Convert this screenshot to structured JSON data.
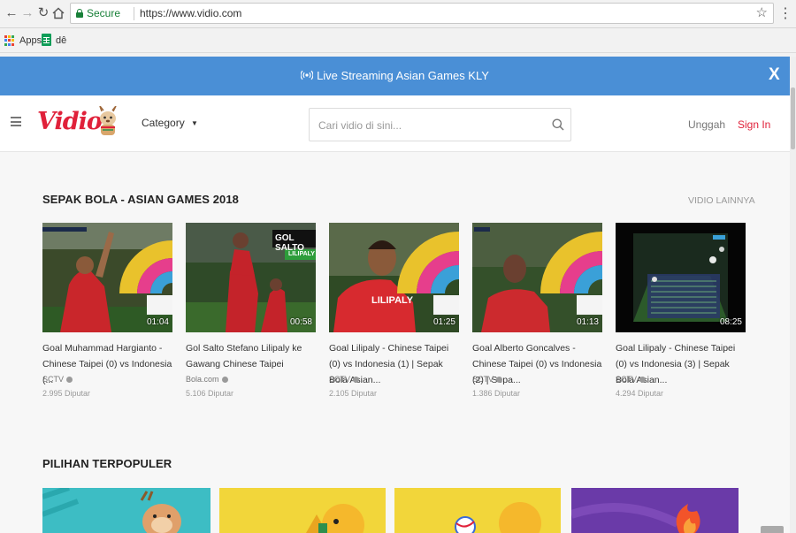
{
  "browser": {
    "secure_label": "Secure",
    "url": "https://www.vidio.com",
    "bookmarks": [
      {
        "label": "Apps",
        "icon": "apps-grid-icon"
      },
      {
        "label": "dê",
        "icon": "sheets-icon"
      }
    ]
  },
  "banner": {
    "text": "Live Streaming Asian Games KLY",
    "close_label": "X",
    "color": "#4a8fd6"
  },
  "header": {
    "logo": "Vidio",
    "category_label": "Category",
    "search_placeholder": "Cari vidio di sini...",
    "upload_label": "Unggah",
    "signin_label": "Sign In",
    "brand_color": "#e0213a"
  },
  "section_football": {
    "title": "SEPAK BOLA - ASIAN GAMES 2018",
    "more_label": "VIDIO LAINNYA",
    "videos": [
      {
        "title": "Goal Muhammad Hargianto - Chinese Taipei (0) vs Indonesia (...",
        "channel": "SCTV",
        "views": "2.995 Diputar",
        "duration": "01:04"
      },
      {
        "title": "Gol Salto Stefano Lilipaly ke Gawang Chinese Taipei",
        "channel": "Bola.com",
        "views": "5.106 Diputar",
        "duration": "00:58",
        "overlay_top": "GOL SALTO",
        "overlay_bottom": "LILIPALY"
      },
      {
        "title": "Goal Lilipaly - Chinese Taipei (0) vs Indonesia (1) | Sepak Bola Asian...",
        "channel": "SCTV",
        "views": "2.105 Diputar",
        "duration": "01:25",
        "overlay_text": "LILIPALY"
      },
      {
        "title": "Goal Alberto Goncalves - Chinese Taipei (0) vs Indonesia (2) | Sepa...",
        "channel": "SCTV",
        "views": "1.386 Diputar",
        "duration": "01:13"
      },
      {
        "title": "Goal Lilipaly - Chinese Taipei (0) vs Indonesia (3) | Sepak Bola Asian...",
        "channel": "SCTV",
        "views": "4.294 Diputar",
        "duration": "08:25"
      }
    ]
  },
  "section_popular": {
    "title": "PILIHAN TERPOPULER"
  }
}
